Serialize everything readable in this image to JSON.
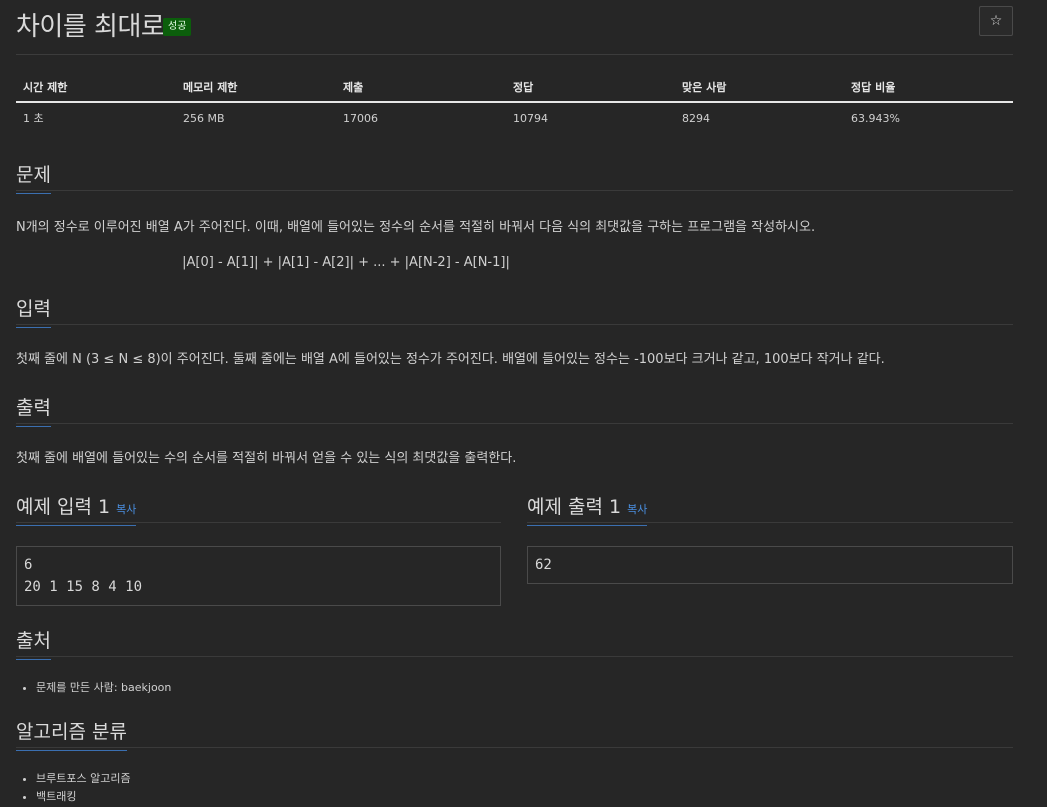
{
  "header": {
    "title": "차이를 최대로",
    "badge": "성공",
    "star_icon": "star-icon"
  },
  "info_table": {
    "headers": [
      "시간 제한",
      "메모리 제한",
      "제출",
      "정답",
      "맞은 사람",
      "정답 비율"
    ],
    "values": [
      "1 초",
      "256 MB",
      "17006",
      "10794",
      "8294",
      "63.943%"
    ]
  },
  "problem": {
    "heading": "문제",
    "text": "N개의 정수로 이루어진 배열 A가 주어진다. 이때, 배열에 들어있는 정수의 순서를 적절히 바꿔서 다음 식의 최댓값을 구하는 프로그램을 작성하시오.",
    "formula": "|A[0] - A[1]| + |A[1] - A[2]| + ... + |A[N-2] - A[N-1]|"
  },
  "input": {
    "heading": "입력",
    "text": "첫째 줄에 N (3 ≤ N ≤ 8)이 주어진다. 둘째 줄에는 배열 A에 들어있는 정수가 주어진다. 배열에 들어있는 정수는 -100보다 크거나 같고, 100보다 작거나 같다."
  },
  "output": {
    "heading": "출력",
    "text": "첫째 줄에 배열에 들어있는 수의 순서를 적절히 바꿔서 얻을 수 있는 식의 최댓값을 출력한다."
  },
  "samples": {
    "input_heading": "예제 입력 1",
    "output_heading": "예제 출력 1",
    "copy_label": "복사",
    "input_lines": [
      "6",
      "20 1 15 8 4 10"
    ],
    "output_lines": [
      "62"
    ]
  },
  "source": {
    "heading": "출처",
    "items": [
      "문제를 만든 사람: baekjoon"
    ]
  },
  "algorithm": {
    "heading": "알고리즘 분류",
    "items": [
      "브루트포스 알고리즘",
      "백트래킹"
    ]
  }
}
